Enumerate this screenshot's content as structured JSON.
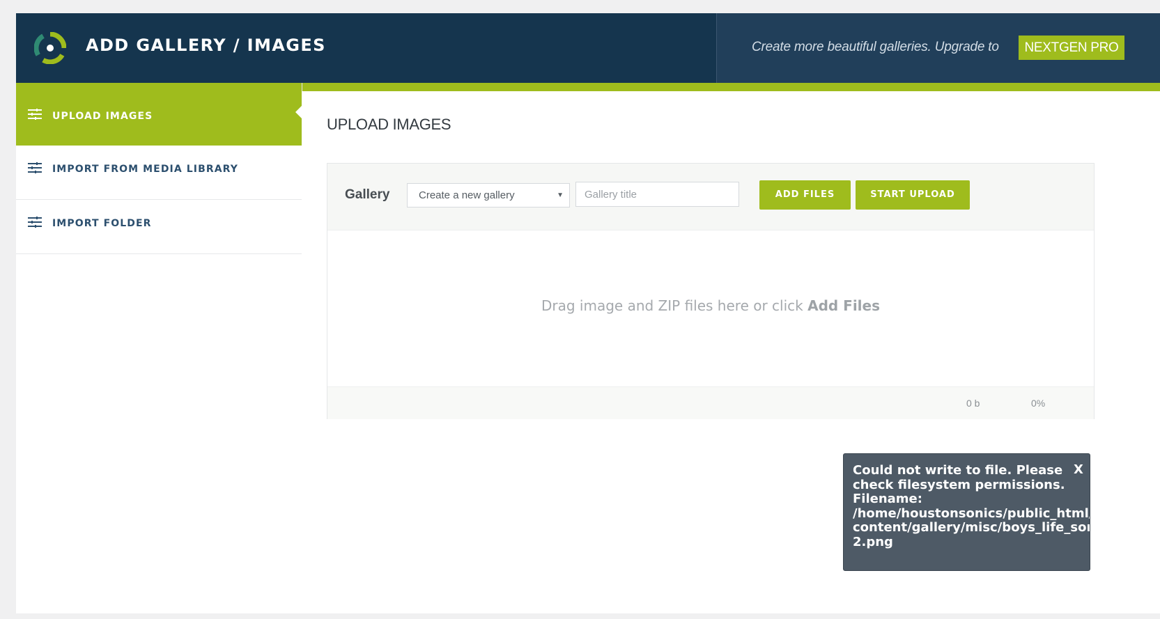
{
  "header": {
    "title": "ADD GALLERY / IMAGES",
    "upgrade_text": "Create more beautiful galleries. Upgrade to",
    "upgrade_button": "NEXTGEN PRO"
  },
  "sidebar": {
    "items": [
      {
        "label": "UPLOAD IMAGES",
        "active": true
      },
      {
        "label": "IMPORT FROM MEDIA LIBRARY",
        "active": false
      },
      {
        "label": "IMPORT FOLDER",
        "active": false
      }
    ]
  },
  "main": {
    "section_title": "UPLOAD IMAGES",
    "gallery_label": "Gallery",
    "gallery_select_value": "Create a new gallery",
    "gallery_title_placeholder": "Gallery title",
    "add_files_button": "ADD FILES",
    "start_upload_button": "START UPLOAD",
    "drop_text_prefix": "Drag image and ZIP files here or click ",
    "drop_text_strong": "Add Files",
    "total_size": "0 b",
    "progress_percent": "0%"
  },
  "toast": {
    "close_label": "X",
    "lines": [
      "Could not write to file. Please",
      "check filesystem permissions.",
      "Filename:",
      "/home/houstonsonics/public_html/wp-",
      "content/gallery/misc/boys_life_sonics-",
      "2.png"
    ]
  },
  "colors": {
    "header_bg": "#15354e",
    "header_right_bg": "#213f5a",
    "accent_green": "#9fbc1d",
    "nav_text": "#2c4f6e",
    "toast_bg": "#4e5a66"
  },
  "icons": {
    "logo": "nextgen-logo-icon",
    "nav": "sliders-icon",
    "select_caret": "caret-down-icon"
  }
}
